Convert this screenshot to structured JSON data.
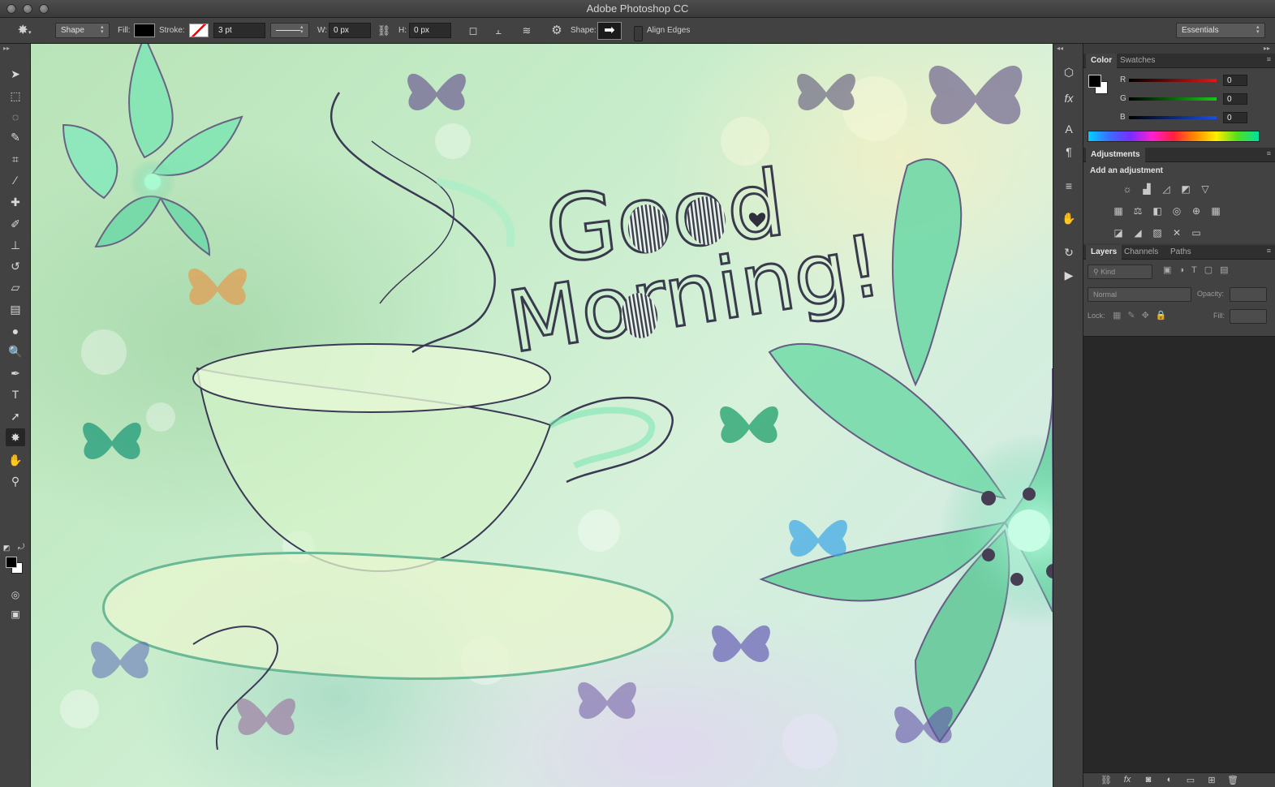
{
  "window": {
    "title": "Adobe Photoshop CC"
  },
  "options_bar": {
    "tool_mode": "Shape",
    "fill_label": "Fill:",
    "stroke_label": "Stroke:",
    "stroke_width": "3 pt",
    "w_label": "W:",
    "w_value": "0 px",
    "h_label": "H:",
    "h_value": "0 px",
    "shape_label": "Shape:",
    "align_edges_label": "Align Edges",
    "workspace": "Essentials"
  },
  "toolbar": {
    "tools": [
      {
        "name": "move-tool",
        "glyph": "➤"
      },
      {
        "name": "marquee-tool",
        "glyph": "⬚"
      },
      {
        "name": "lasso-tool",
        "glyph": "◌"
      },
      {
        "name": "quick-selection-tool",
        "glyph": "✎"
      },
      {
        "name": "crop-tool",
        "glyph": "⌗"
      },
      {
        "name": "eyedropper-tool",
        "glyph": "⁄"
      },
      {
        "name": "healing-brush-tool",
        "glyph": "✚"
      },
      {
        "name": "brush-tool",
        "glyph": "✐"
      },
      {
        "name": "clone-stamp-tool",
        "glyph": "⊥"
      },
      {
        "name": "history-brush-tool",
        "glyph": "↺"
      },
      {
        "name": "eraser-tool",
        "glyph": "▱"
      },
      {
        "name": "gradient-tool",
        "glyph": "▤"
      },
      {
        "name": "blur-tool",
        "glyph": "●"
      },
      {
        "name": "dodge-tool",
        "glyph": "🔍"
      },
      {
        "name": "pen-tool",
        "glyph": "✒"
      },
      {
        "name": "type-tool",
        "glyph": "T"
      },
      {
        "name": "path-selection-tool",
        "glyph": "➚"
      },
      {
        "name": "custom-shape-tool",
        "glyph": "✸"
      },
      {
        "name": "hand-tool",
        "glyph": "✋"
      },
      {
        "name": "zoom-tool",
        "glyph": "⚲"
      }
    ],
    "active_tool": "custom-shape-tool"
  },
  "canvas_artwork": {
    "headline_line1": "Good",
    "headline_line2": "Morning!"
  },
  "color_panel": {
    "tabs": [
      "Color",
      "Swatches"
    ],
    "active_tab": "Color",
    "channels": [
      {
        "label": "R",
        "value": "0",
        "color": "#e01818"
      },
      {
        "label": "G",
        "value": "0",
        "color": "#18c818"
      },
      {
        "label": "B",
        "value": "0",
        "color": "#1850e8"
      }
    ]
  },
  "adjustments_panel": {
    "tab": "Adjustments",
    "heading": "Add an adjustment",
    "icons": [
      [
        "brightness-contrast-icon",
        "levels-icon",
        "curves-icon",
        "exposure-icon",
        "vibrance-icon"
      ],
      [
        "hue-saturation-icon",
        "color-balance-icon",
        "black-white-icon",
        "photo-filter-icon",
        "channel-mixer-icon",
        "color-lookup-icon"
      ],
      [
        "invert-icon",
        "posterize-icon",
        "threshold-icon",
        "selective-color-icon",
        "gradient-map-icon"
      ]
    ],
    "glyphs": [
      [
        "☼",
        "▟",
        "◿",
        "◩",
        "▽"
      ],
      [
        "▦",
        "⚖",
        "◧",
        "◎",
        "⊕",
        "▦"
      ],
      [
        "◪",
        "◢",
        "▨",
        "✕",
        "▭"
      ]
    ]
  },
  "layers_panel": {
    "tabs": [
      "Layers",
      "Channels",
      "Paths"
    ],
    "active_tab": "Layers",
    "filter_kind": "Kind",
    "blend_mode": "Normal",
    "opacity_label": "Opacity:",
    "lock_label": "Lock:",
    "fill_label": "Fill:"
  },
  "accent_colors": {
    "mint": "#7fe6b4",
    "panel_bg": "#424242",
    "dark_bg": "#282828"
  }
}
